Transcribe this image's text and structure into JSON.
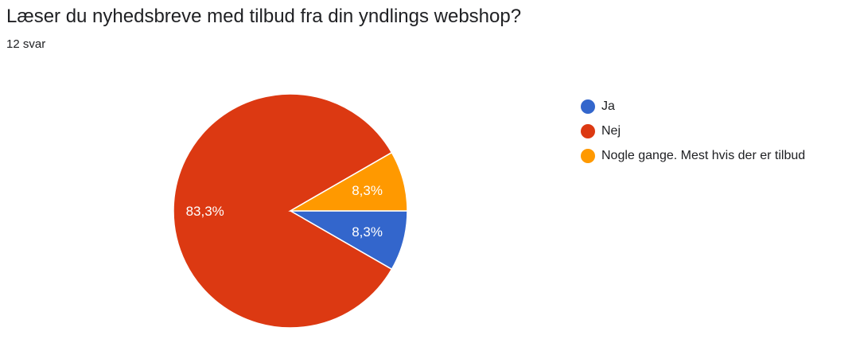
{
  "header": {
    "title": "Læser du nyhedsbreve med tilbud fra din yndlings webshop?",
    "responses": "12 svar"
  },
  "chart_data": {
    "type": "pie",
    "title": "Læser du nyhedsbreve med tilbud fra din yndlings webshop?",
    "subtitle": "12 svar",
    "slices": [
      {
        "label": "Ja",
        "percent": 8.3,
        "display": "8,3%",
        "color": "#3366cc"
      },
      {
        "label": "Nej",
        "percent": 83.3,
        "display": "83,3%",
        "color": "#dc3912"
      },
      {
        "label": "Nogle gange. Mest hvis der er tilbud",
        "percent": 8.3,
        "display": "8,3%",
        "color": "#ff9900"
      }
    ],
    "legend_position": "right"
  }
}
